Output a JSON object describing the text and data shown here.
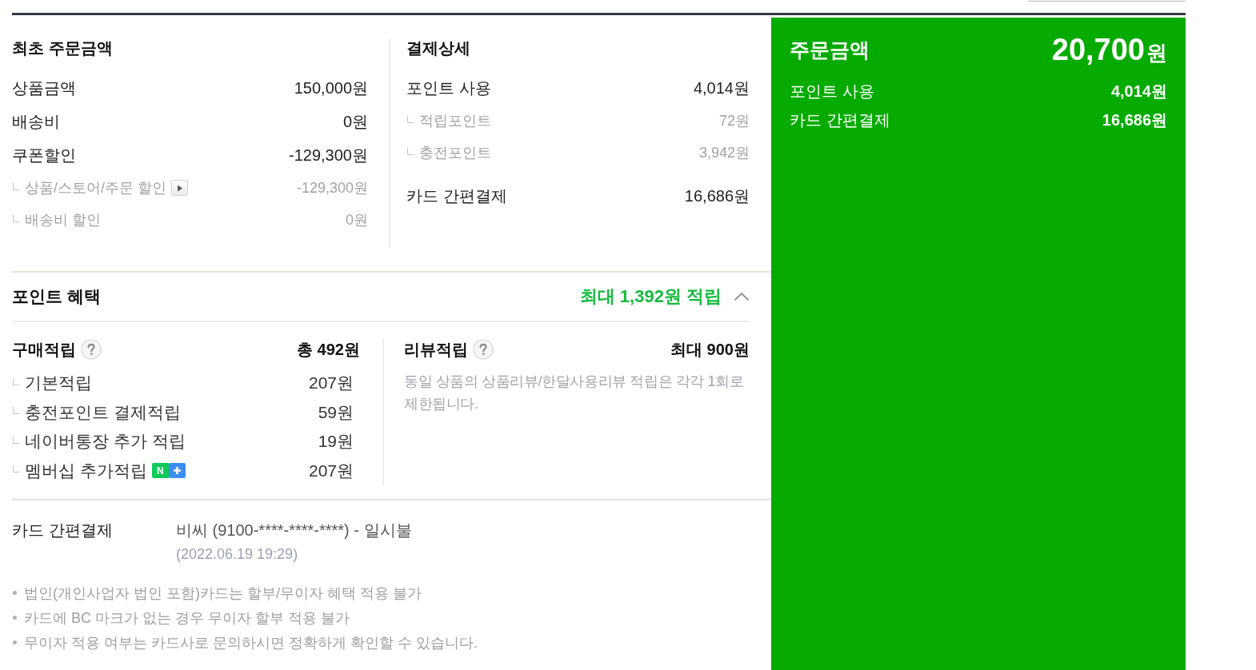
{
  "order_summary": {
    "title": "최초 주문금액",
    "rows": [
      {
        "label": "상품금액",
        "value": "150,000원",
        "kind": "main"
      },
      {
        "label": "배송비",
        "value": "0원",
        "kind": "main"
      },
      {
        "label": "쿠폰할인",
        "value": "-129,300원",
        "kind": "main"
      },
      {
        "label": "상품/스토어/주문 할인",
        "value": "-129,300원",
        "kind": "sub",
        "detail_button": true
      },
      {
        "label": "배송비 할인",
        "value": "0원",
        "kind": "sub"
      }
    ]
  },
  "payment_detail": {
    "title": "결제상세",
    "rows": [
      {
        "label": "포인트 사용",
        "value": "4,014원",
        "kind": "main"
      },
      {
        "label": "적립포인트",
        "value": "72원",
        "kind": "sub"
      },
      {
        "label": "충전포인트",
        "value": "3,942원",
        "kind": "sub"
      },
      {
        "label": "카드 간편결제",
        "value": "16,686원",
        "kind": "main"
      }
    ]
  },
  "point_benefits": {
    "title": "포인트 혜택",
    "summary": "최대 1,392원 적립",
    "expanded": true,
    "purchase": {
      "title": "구매적립",
      "total": "총 492원",
      "rows": [
        {
          "label": "기본적립",
          "value": "207원"
        },
        {
          "label": "충전포인트 결제적립",
          "value": "59원"
        },
        {
          "label": "네이버통장 추가 적립",
          "value": "19원"
        },
        {
          "label": "멤버십 추가적립",
          "value": "207원",
          "badge": "N"
        }
      ]
    },
    "review": {
      "title": "리뷰적립",
      "total": "최대 900원",
      "note": "동일 상품의 상품리뷰/한달사용리뷰 적립은 각각 1회로 제한됩니다."
    }
  },
  "payment_method": {
    "label": "카드 간편결제",
    "detail": "비씨 (9100-****-****-****) - 일시불",
    "date": "(2022.06.19 19:29)"
  },
  "notices": [
    "법인(개인사업자 법인 포함)카드는 할부/무이자 혜택 적용 불가",
    "카드에 BC 마크가 없는 경우 무이자 할부 적용 불가",
    "무이자 적용 여부는 카드사로 문의하시면 정확하게 확인할 수 있습니다."
  ],
  "total_panel": {
    "title": "주문금액",
    "amount": "20,700",
    "unit": "원",
    "rows": [
      {
        "label": "포인트 사용",
        "value": "4,014원"
      },
      {
        "label": "카드 간편결제",
        "value": "16,686원"
      }
    ]
  }
}
